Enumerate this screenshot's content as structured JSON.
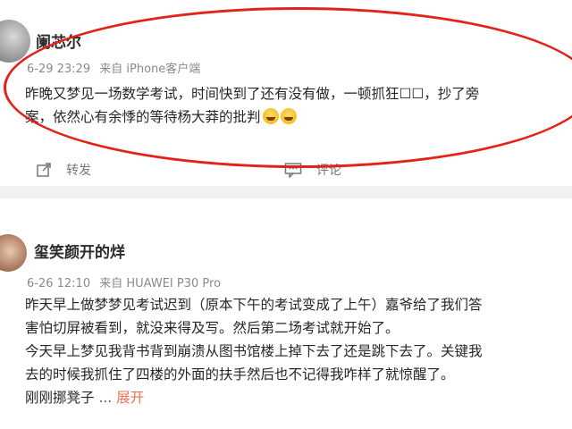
{
  "posts": [
    {
      "username": "阑芯尔",
      "meta": {
        "date": "6-29 23:29",
        "source": "来自 iPhone客户端"
      },
      "lines": [
        "昨晚又梦见一场数学考试，时间快到了还有没有做，一顿抓狂☐☐，抄了旁",
        "案，依然心有余悸的等待杨大莽的批判"
      ],
      "actions": {
        "repost": "转发",
        "comment": "评论"
      }
    },
    {
      "username": "玺笑颜开的烊",
      "meta": {
        "date": "6-26 12:10",
        "source": "来自 HUAWEI P30 Pro"
      },
      "lines": [
        "昨天早上做梦梦见考试迟到（原本下午的考试变成了上午）嘉爷给了我们答",
        "害怕切屏被看到，就没来得及写。然后第二场考试就开始了。",
        "今天早上梦见我背书背到崩溃从图书馆楼上掉下去了还是跳下去了。关键我",
        "去的时候我抓住了四楼的外面的扶手然后也不记得我咋样了就惊醒了。"
      ],
      "last_line": "刚刚挪凳子",
      "ellipsis": "...",
      "expand": "展开"
    }
  ],
  "colors": {
    "highlight_ring": "#e2231a",
    "expand_link": "#eb7350",
    "meta": "#8a8a8a"
  }
}
